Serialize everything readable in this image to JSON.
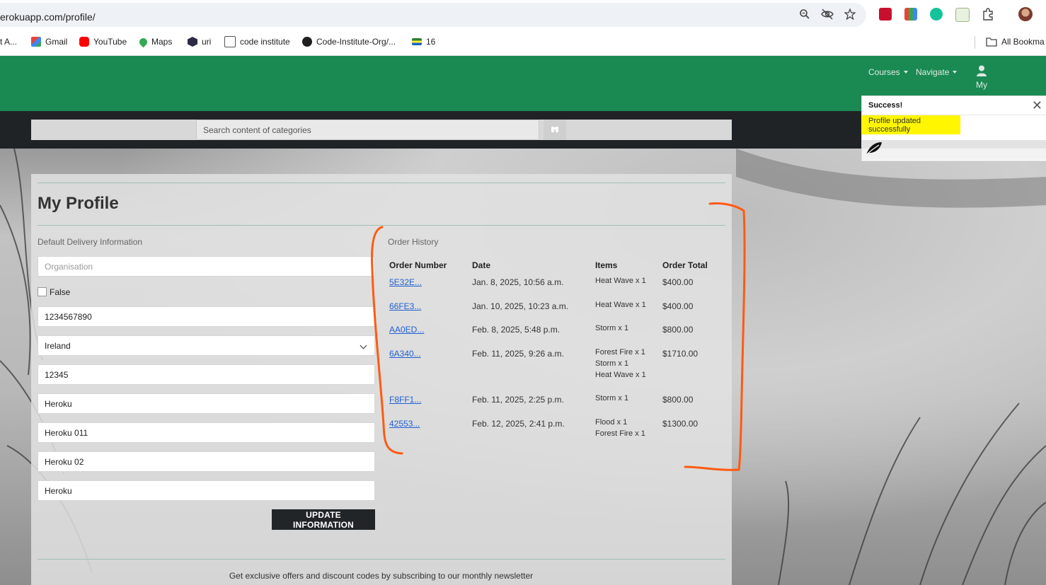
{
  "browser": {
    "url": "erokuapp.com/profile/",
    "bookmarks": [
      {
        "label": "t A...",
        "icon": "generic-icon"
      },
      {
        "label": "Gmail",
        "icon": "gmail-icon"
      },
      {
        "label": "YouTube",
        "icon": "youtube-icon"
      },
      {
        "label": "Maps",
        "icon": "maps-icon"
      },
      {
        "label": "uri",
        "icon": "uri-icon"
      },
      {
        "label": "code institute",
        "icon": "code-institute-icon"
      },
      {
        "label": "Code-Institute-Org/...",
        "icon": "github-icon"
      },
      {
        "label": "16",
        "icon": "flag-icon"
      }
    ],
    "all_bookmarks": "All Bookma"
  },
  "nav": {
    "courses": "Courses",
    "navigate": "Navigate",
    "account": "My"
  },
  "search": {
    "placeholder": "Search content of categories"
  },
  "profile": {
    "title": "My Profile",
    "delivery_label": "Default Delivery Information",
    "fields": {
      "organisation_placeholder": "Organisation",
      "checkbox_label": "False",
      "phone": "1234567890",
      "country": "Ireland",
      "postcode": "12345",
      "town": "Heroku",
      "address1": "Heroku 011",
      "address2": "Heroku 02",
      "county": "Heroku"
    },
    "update_button": "UPDATE INFORMATION"
  },
  "orders": {
    "label": "Order History",
    "headers": [
      "Order Number",
      "Date",
      "Items",
      "Order Total"
    ],
    "rows": [
      {
        "number": "5E32E...",
        "date": "Jan. 8, 2025, 10:56 a.m.",
        "items": [
          "Heat Wave x 1"
        ],
        "total": "$400.00"
      },
      {
        "number": "66FE3...",
        "date": "Jan. 10, 2025, 10:23 a.m.",
        "items": [
          "Heat Wave x 1"
        ],
        "total": "$400.00"
      },
      {
        "number": "AA0ED...",
        "date": "Feb. 8, 2025, 5:48 p.m.",
        "items": [
          "Storm x 1"
        ],
        "total": "$800.00"
      },
      {
        "number": "6A340...",
        "date": "Feb. 11, 2025, 9:26 a.m.",
        "items": [
          "Forest Fire x 1",
          "Storm x 1",
          "Heat Wave x 1"
        ],
        "total": "$1710.00"
      },
      {
        "number": "F8FF1...",
        "date": "Feb. 11, 2025, 2:25 p.m.",
        "items": [
          "Storm x 1"
        ],
        "total": "$800.00"
      },
      {
        "number": "42553...",
        "date": "Feb. 12, 2025, 2:41 p.m.",
        "items": [
          "Flood x 1",
          "Forest Fire x 1"
        ],
        "total": "$1300.00"
      }
    ]
  },
  "toast": {
    "title": "Success!",
    "message": "Profile updated successfully"
  },
  "footer": {
    "newsletter": "Get exclusive offers and discount codes by subscribing to our monthly newsletter"
  },
  "colors": {
    "nav_green": "#1a8a52",
    "dark_bar": "#202326",
    "link_blue": "#1f5fd1",
    "highlight_yellow": "#fff600",
    "annotation_orange": "#ff5a12"
  }
}
